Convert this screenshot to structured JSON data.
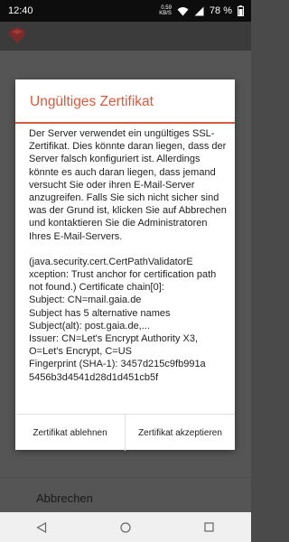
{
  "status_bar": {
    "time": "12:40",
    "net_speed": "0.59",
    "net_unit": "KB/S",
    "battery": "78 %"
  },
  "app": {
    "cancel_label": "Abbrechen"
  },
  "dialog": {
    "title": "Ungültiges Zertifikat",
    "message": "Der Server verwendet ein ungültiges SSL-Zertifikat. Dies könnte daran liegen, dass der Server falsch konfiguriert ist. Allerdings könnte es auch daran liegen, dass jemand versucht Sie oder ihren E-Mail-Server anzugreifen. Falls Sie sich nicht sicher sind was der Grund ist, klicken Sie auf Abbrechen und kontaktieren Sie die Administratoren Ihres E-Mail-Servers.",
    "details": "(java.security.cert.CertPathValidatorE\nxception: Trust anchor for certification path not found.) Certificate chain[0]:\nSubject: CN=mail.gaia.de\nSubject has 5 alternative names\nSubject(alt): post.gaia.de,...\nIssuer: CN=Let's Encrypt Authority X3, O=Let's Encrypt, C=US\nFingerprint (SHA-1): 3457d215c9fb991a\n5456b3d4541d28d1d451cb5f",
    "reject_label": "Zertifikat ablehnen",
    "accept_label": "Zertifikat akzeptieren"
  },
  "colors": {
    "accent": "#d9593d",
    "overlay": "#4a4a4a"
  },
  "icons": {
    "wifi": "wifi-icon",
    "signal": "signal-icon",
    "battery": "battery-icon",
    "back": "back-icon",
    "home": "home-icon",
    "recents": "recents-icon",
    "logo": "app-logo-icon"
  }
}
